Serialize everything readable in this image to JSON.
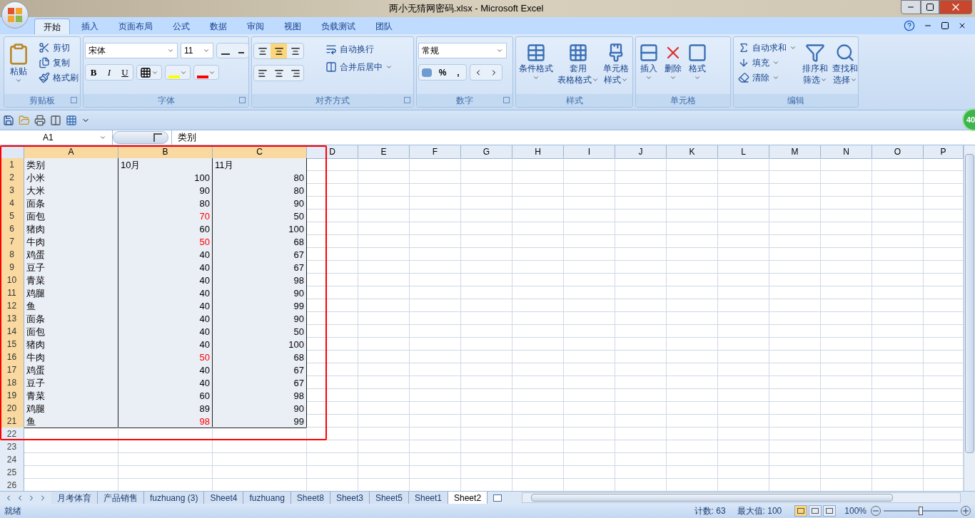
{
  "window": {
    "title": "两小无猜网密码.xlsx - Microsoft Excel"
  },
  "ribbon": {
    "tabs": [
      {
        "label": "开始",
        "selected": true
      },
      {
        "label": "插入",
        "selected": false
      },
      {
        "label": "页面布局",
        "selected": false
      },
      {
        "label": "公式",
        "selected": false
      },
      {
        "label": "数据",
        "selected": false
      },
      {
        "label": "审阅",
        "selected": false
      },
      {
        "label": "视图",
        "selected": false
      },
      {
        "label": "负载测试",
        "selected": false
      },
      {
        "label": "团队",
        "selected": false
      }
    ],
    "groups": [
      {
        "kind": "clipboard",
        "label": "剪贴板",
        "large": "粘贴",
        "small": [
          "剪切",
          "复制",
          "格式刷"
        ]
      },
      {
        "kind": "font",
        "label": "字体",
        "font": "宋体",
        "size": "11",
        "styles": [
          "B",
          "I",
          "U"
        ]
      },
      {
        "kind": "alignment",
        "label": "对齐方式",
        "vertical": [
          {
            "selected": false
          },
          {
            "selected": true
          },
          {
            "selected": false
          }
        ],
        "small": [
          "自动换行",
          "合并后居中"
        ]
      },
      {
        "kind": "number",
        "label": "数字",
        "format": "常规",
        "symbols": [
          "%",
          ","
        ]
      },
      {
        "kind": "styles",
        "label": "样式",
        "large": [
          [
            "条件格式"
          ],
          [
            "套用",
            "表格格式"
          ],
          [
            "单元格",
            "样式"
          ]
        ]
      },
      {
        "kind": "cells",
        "label": "单元格",
        "large": [
          [
            "插入"
          ],
          [
            "删除"
          ],
          [
            "格式"
          ]
        ]
      },
      {
        "kind": "editing",
        "label": "编辑",
        "small": [
          "自动求和",
          "填充",
          "清除"
        ],
        "large": [
          [
            "排序和",
            "筛选"
          ],
          [
            "查找和",
            "选择"
          ]
        ]
      }
    ]
  },
  "badge": "40",
  "formula_bar": {
    "name_box": "A1",
    "content": "类别"
  },
  "sheet": {
    "columns": [
      {
        "label": "A",
        "selected": true
      },
      {
        "label": "B",
        "selected": true
      },
      {
        "label": "C",
        "selected": true
      },
      {
        "label": "D",
        "selected": false
      },
      {
        "label": "E",
        "selected": false
      },
      {
        "label": "F",
        "selected": false
      },
      {
        "label": "G",
        "selected": false
      },
      {
        "label": "H",
        "selected": false
      },
      {
        "label": "I",
        "selected": false
      },
      {
        "label": "J",
        "selected": false
      },
      {
        "label": "K",
        "selected": false
      },
      {
        "label": "L",
        "selected": false
      },
      {
        "label": "M",
        "selected": false
      },
      {
        "label": "N",
        "selected": false
      },
      {
        "label": "O",
        "selected": false
      },
      {
        "label": "P",
        "selected": false
      }
    ],
    "rows": [
      {
        "number": "1",
        "selected": true,
        "kind": "header",
        "cells": [
          "类别",
          "10月",
          "11月"
        ]
      },
      {
        "number": "2",
        "selected": true,
        "kind": "data",
        "cells": [
          "小米",
          "100",
          "80"
        ],
        "flagged": false
      },
      {
        "number": "3",
        "selected": true,
        "kind": "data",
        "cells": [
          "大米",
          "90",
          "80"
        ],
        "flagged": false
      },
      {
        "number": "4",
        "selected": true,
        "kind": "data",
        "cells": [
          "面条",
          "80",
          "90"
        ],
        "flagged": false
      },
      {
        "number": "5",
        "selected": true,
        "kind": "data",
        "cells": [
          "面包",
          "70",
          "50"
        ],
        "flagged": true
      },
      {
        "number": "6",
        "selected": true,
        "kind": "data",
        "cells": [
          "猪肉",
          "60",
          "100"
        ],
        "flagged": false
      },
      {
        "number": "7",
        "selected": true,
        "kind": "data",
        "cells": [
          "牛肉",
          "50",
          "68"
        ],
        "flagged": true
      },
      {
        "number": "8",
        "selected": true,
        "kind": "data",
        "cells": [
          "鸡蛋",
          "40",
          "67"
        ],
        "flagged": false
      },
      {
        "number": "9",
        "selected": true,
        "kind": "data",
        "cells": [
          "豆子",
          "40",
          "67"
        ],
        "flagged": false
      },
      {
        "number": "10",
        "selected": true,
        "kind": "data",
        "cells": [
          "青菜",
          "40",
          "98"
        ],
        "flagged": false
      },
      {
        "number": "11",
        "selected": true,
        "kind": "data",
        "cells": [
          "鸡腿",
          "40",
          "90"
        ],
        "flagged": false
      },
      {
        "number": "12",
        "selected": true,
        "kind": "data",
        "cells": [
          "鱼",
          "40",
          "99"
        ],
        "flagged": false
      },
      {
        "number": "13",
        "selected": true,
        "kind": "data",
        "cells": [
          "面条",
          "40",
          "90"
        ],
        "flagged": false
      },
      {
        "number": "14",
        "selected": true,
        "kind": "data",
        "cells": [
          "面包",
          "40",
          "50"
        ],
        "flagged": false
      },
      {
        "number": "15",
        "selected": true,
        "kind": "data",
        "cells": [
          "猪肉",
          "40",
          "100"
        ],
        "flagged": false
      },
      {
        "number": "16",
        "selected": true,
        "kind": "data",
        "cells": [
          "牛肉",
          "50",
          "68"
        ],
        "flagged": true
      },
      {
        "number": "17",
        "selected": true,
        "kind": "data",
        "cells": [
          "鸡蛋",
          "40",
          "67"
        ],
        "flagged": false
      },
      {
        "number": "18",
        "selected": true,
        "kind": "data",
        "cells": [
          "豆子",
          "40",
          "67"
        ],
        "flagged": false
      },
      {
        "number": "19",
        "selected": true,
        "kind": "data",
        "cells": [
          "青菜",
          "60",
          "98"
        ],
        "flagged": false
      },
      {
        "number": "20",
        "selected": true,
        "kind": "data",
        "cells": [
          "鸡腿",
          "89",
          "90"
        ],
        "flagged": false
      },
      {
        "number": "21",
        "selected": true,
        "kind": "data",
        "cells": [
          "鱼",
          "98",
          "99"
        ],
        "flagged": true
      },
      {
        "number": "22",
        "selected": false,
        "kind": "empty"
      },
      {
        "number": "23",
        "selected": false,
        "kind": "empty"
      },
      {
        "number": "24",
        "selected": false,
        "kind": "empty"
      },
      {
        "number": "25",
        "selected": false,
        "kind": "empty"
      },
      {
        "number": "26",
        "selected": false,
        "kind": "empty"
      }
    ]
  },
  "sheet_tabs": [
    {
      "label": "月考体育",
      "selected": false
    },
    {
      "label": "产品销售",
      "selected": false
    },
    {
      "label": "fuzhuang (3)",
      "selected": false
    },
    {
      "label": "Sheet4",
      "selected": false
    },
    {
      "label": "fuzhuang",
      "selected": false
    },
    {
      "label": "Sheet8",
      "selected": false
    },
    {
      "label": "Sheet3",
      "selected": false
    },
    {
      "label": "Sheet5",
      "selected": false
    },
    {
      "label": "Sheet1",
      "selected": false
    },
    {
      "label": "Sheet2",
      "selected": true
    }
  ],
  "status_bar": {
    "status": "就绪",
    "count": "计数: 63",
    "max": "最大值: 100",
    "views": [
      {
        "selected": true
      },
      {
        "selected": false
      },
      {
        "selected": false
      }
    ],
    "zoom": "100%",
    "zoom_slider": {
      "level": 0.5
    }
  }
}
